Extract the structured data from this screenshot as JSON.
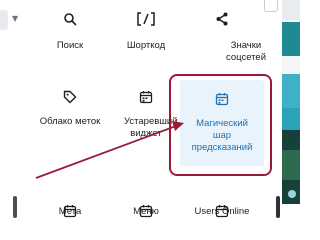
{
  "colors": {
    "text": "#1e1e1e",
    "accent": "#2271b1",
    "highlight_bg": "#e8f3fb",
    "annotation": "#9b1b37"
  },
  "blocks": [
    {
      "label": "Поиск",
      "icon": "search-icon"
    },
    {
      "label": "Шорткод",
      "icon": "shortcode-icon"
    },
    {
      "label": "Значки соцсетей",
      "icon": "share-icon"
    },
    {
      "label": "Облако меток",
      "icon": "tag-icon"
    },
    {
      "label": "Устаревший виджет",
      "icon": "calendar-icon"
    },
    {
      "label": "Магический шар предсказаний",
      "icon": "calendar-icon",
      "selected": true
    },
    {
      "label": "Мета",
      "icon": "calendar-icon"
    },
    {
      "label": "Меню",
      "icon": "calendar-icon"
    },
    {
      "label": "Users Online",
      "icon": "calendar-icon"
    }
  ],
  "annotation": {
    "type": "arrow-with-box",
    "target": "Магический шар предсказаний"
  }
}
